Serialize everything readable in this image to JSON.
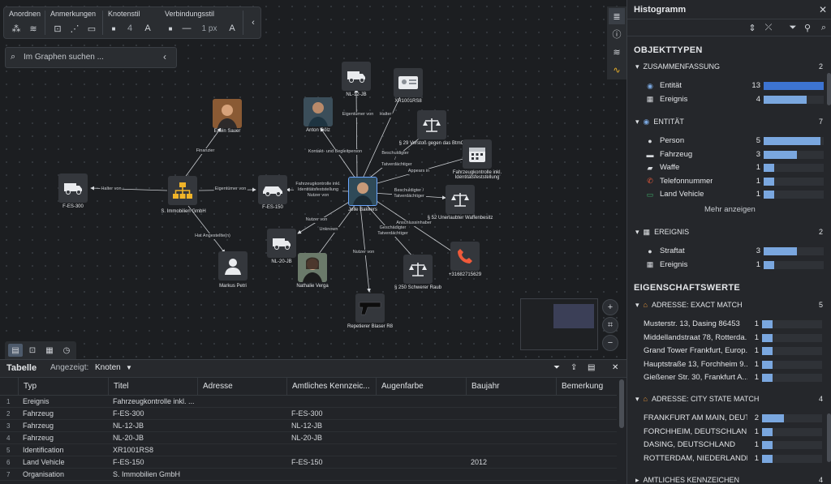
{
  "toolbar": {
    "groups": [
      "Anordnen",
      "Anmerkungen",
      "Knotenstil",
      "Verbindungsstil"
    ],
    "node_size": "4",
    "edge_width": "1 px"
  },
  "search": {
    "placeholder": "Im Graphen suchen ..."
  },
  "graph": {
    "nodes": [
      {
        "label": "NL-12-JB"
      },
      {
        "label": "XR1001RS8"
      },
      {
        "label": "Erwin Sauer"
      },
      {
        "label": "Anton Gölz"
      },
      {
        "label": "§ 29 Verstoß gegen das BtmG"
      },
      {
        "label": "Fahrzeugkontrolle inkl. Identitätsfeststellung"
      },
      {
        "label": "F-ES-300"
      },
      {
        "label": "S. Immobilien GmbH"
      },
      {
        "label": "F-ES-150"
      },
      {
        "label": "Jelle Bakkers"
      },
      {
        "label": "§ 52 Unerlaubter Waffenbesitz"
      },
      {
        "label": "NL-20-JB"
      },
      {
        "label": "Nathalie Verga"
      },
      {
        "label": "Markus Petri"
      },
      {
        "label": "§ 250 Schwerer Raub"
      },
      {
        "label": "+31682715629"
      },
      {
        "label": "Repetierer Blaser R8"
      }
    ],
    "edges": [
      {
        "label": "Finanzier"
      },
      {
        "label": "Halter von"
      },
      {
        "label": "Eigentümer von"
      },
      {
        "label": "Hat Angestellte(n)"
      },
      {
        "label": "Eigentümer von"
      },
      {
        "label": "Kontakt- und Begleitperson"
      },
      {
        "label": "Halter"
      },
      {
        "label": "Beschuldigter / Tatverdächtiger"
      },
      {
        "label": "Appears in"
      },
      {
        "label": "Fahrzeugkontrolle inkl. Identitätsfeststellung Nutzer von"
      },
      {
        "label": "Beschuldigter / Tatverdächtiger"
      },
      {
        "label": "Anschlussinhaber"
      },
      {
        "label": "Nutzer von"
      },
      {
        "label": "Unknown"
      },
      {
        "label": "Geschädigter Tatverdächtiger"
      },
      {
        "label": "Nutzer von"
      }
    ]
  },
  "table": {
    "title": "Tabelle",
    "shown_label": "Angezeigt:",
    "shown_value": "Knoten",
    "columns": [
      "Typ",
      "Titel",
      "Adresse",
      "Amtliches Kennzeic...",
      "Augenfarbe",
      "Baujahr",
      "Bemerkung"
    ],
    "rows": [
      {
        "n": "1",
        "typ": "Ereignis",
        "titel": "Fahrzeugkontrolle inkl. ...",
        "kennzeichen": "",
        "baujahr": ""
      },
      {
        "n": "2",
        "typ": "Fahrzeug",
        "titel": "F-ES-300",
        "kennzeichen": "F-ES-300",
        "baujahr": ""
      },
      {
        "n": "3",
        "typ": "Fahrzeug",
        "titel": "NL-12-JB",
        "kennzeichen": "NL-12-JB",
        "baujahr": ""
      },
      {
        "n": "4",
        "typ": "Fahrzeug",
        "titel": "NL-20-JB",
        "kennzeichen": "NL-20-JB",
        "baujahr": ""
      },
      {
        "n": "5",
        "typ": "Identification",
        "titel": "XR1001RS8",
        "kennzeichen": "",
        "baujahr": ""
      },
      {
        "n": "6",
        "typ": "Land Vehicle",
        "titel": "F-ES-150",
        "kennzeichen": "F-ES-150",
        "baujahr": "2012"
      },
      {
        "n": "7",
        "typ": "Organisation",
        "titel": "S. Immobilien GmbH",
        "kennzeichen": "",
        "baujahr": ""
      }
    ]
  },
  "histogram": {
    "title": "Histogramm",
    "section_types": "OBJEKTTYPEN",
    "summary": {
      "label": "ZUSAMMENFASSUNG",
      "count": "2",
      "rows": [
        {
          "label": "Entität",
          "count": "13",
          "value": 1.0,
          "icon": "entity-icon"
        },
        {
          "label": "Ereignis",
          "count": "4",
          "value": 0.72,
          "icon": "calendar-icon"
        }
      ]
    },
    "entity": {
      "label": "ENTITÄT",
      "count": "7",
      "rows": [
        {
          "label": "Person",
          "count": "5",
          "value": 0.95,
          "icon": "person-icon"
        },
        {
          "label": "Fahrzeug",
          "count": "3",
          "value": 0.55,
          "icon": "car-icon"
        },
        {
          "label": "Waffe",
          "count": "1",
          "value": 0.18,
          "icon": "gun-icon"
        },
        {
          "label": "Telefonnummer",
          "count": "1",
          "value": 0.18,
          "icon": "phone-icon"
        },
        {
          "label": "Land Vehicle",
          "count": "1",
          "value": 0.18,
          "icon": "land-vehicle-icon"
        }
      ],
      "more": "Mehr anzeigen"
    },
    "event": {
      "label": "EREIGNIS",
      "count": "2",
      "rows": [
        {
          "label": "Straftat",
          "count": "3",
          "value": 0.55,
          "icon": "crime-icon"
        },
        {
          "label": "Ereignis",
          "count": "1",
          "value": 0.18,
          "icon": "calendar-icon"
        }
      ]
    },
    "section_props": "EIGENSCHAFTSWERTE",
    "addr_exact": {
      "label": "ADRESSE: EXACT MATCH",
      "count": "5",
      "rows": [
        {
          "label": "Musterstr. 13, Dasing 86453",
          "count": "1",
          "value": 0.18
        },
        {
          "label": "Middellandstraat 78, Rotterda...",
          "count": "1",
          "value": 0.18
        },
        {
          "label": "Grand Tower Frankfurt, Europ...",
          "count": "1",
          "value": 0.18
        },
        {
          "label": "Hauptstraße 13, Forchheim 9...",
          "count": "1",
          "value": 0.18
        },
        {
          "label": "Gießener Str. 30, Frankfurt A...",
          "count": "1",
          "value": 0.18
        }
      ]
    },
    "addr_city": {
      "label": "ADRESSE: CITY STATE MATCH",
      "count": "4",
      "rows": [
        {
          "label": "FRANKFURT AM MAIN, DEUTS...",
          "count": "2",
          "value": 0.36
        },
        {
          "label": "FORCHHEIM, DEUTSCHLAND",
          "count": "1",
          "value": 0.18
        },
        {
          "label": "DASING, DEUTSCHLAND",
          "count": "1",
          "value": 0.18
        },
        {
          "label": "ROTTERDAM, NIEDERLANDE",
          "count": "1",
          "value": 0.18
        }
      ]
    },
    "plate": {
      "label": "AMTLICHES KENNZEICHEN",
      "count": "4"
    }
  },
  "colors": {
    "accent": "#7aa7df",
    "accent_strong": "#3d74d1",
    "node_bg": "#34373c",
    "org": "#f0b429"
  }
}
